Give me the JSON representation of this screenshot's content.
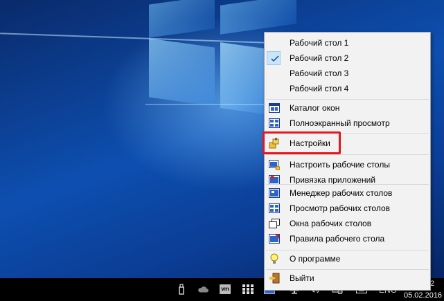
{
  "menu": {
    "desktops": [
      {
        "label": "Рабочий стол 1",
        "checked": false
      },
      {
        "label": "Рабочий стол 2",
        "checked": true
      },
      {
        "label": "Рабочий стол 3",
        "checked": false
      },
      {
        "label": "Рабочий стол 4",
        "checked": false
      }
    ],
    "window_catalog": "Каталог окон",
    "fullscreen_view": "Полноэкранный просмотр",
    "settings": "Настройки",
    "configure_desktops": "Настроить рабочие столы",
    "app_binding": "Привязка приложений",
    "desktop_manager": "Менеджер рабочих столов",
    "desktop_view": "Просмотр рабочих столов",
    "desktop_windows": "Окна рабочих столов",
    "desktop_rules": "Правила рабочего стола",
    "about": "О программе",
    "exit": "Выйти"
  },
  "taskbar": {
    "language": "ENG",
    "clock_time_fragment": "2",
    "clock_date": "05.02.2016",
    "vm_badge": "vm"
  },
  "colors": {
    "highlight": "#e8141e",
    "checked_bg": "#cce4f7",
    "menu_bg": "#f2f2f2"
  }
}
